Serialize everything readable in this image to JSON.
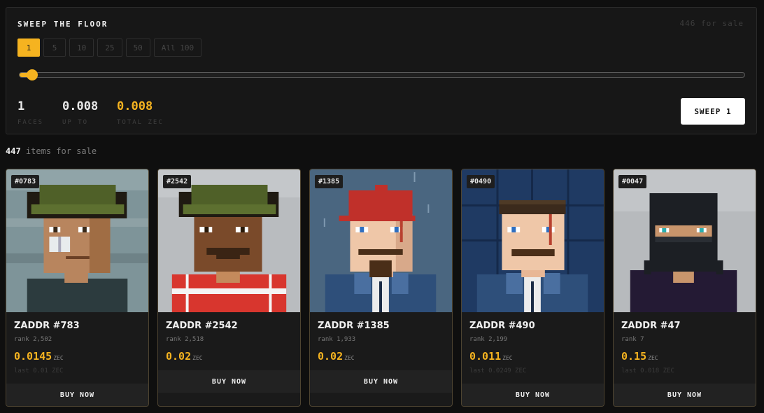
{
  "sweep": {
    "title": "SWEEP THE FLOOR",
    "for_sale": "446 for sale",
    "quantity_options": [
      "1",
      "5",
      "10",
      "25",
      "50",
      "All 100"
    ],
    "selected_quantity": "1",
    "slider_fraction": 0.01,
    "stats": {
      "faces_value": "1",
      "faces_label": "FACES",
      "upto_value": "0.008",
      "upto_label": "UP TO",
      "total_value": "0.008",
      "total_label": "TOTAL ZEC"
    },
    "button_label": "SWEEP 1"
  },
  "listing": {
    "count": "447",
    "suffix": "items for sale"
  },
  "cards": [
    {
      "id": "#0783",
      "name": "ZADDR #783",
      "rank": "rank 2,502",
      "price": "0.0145",
      "unit": "ZEC",
      "last": "last 0.01 ZEC",
      "buy": "BUY NOW"
    },
    {
      "id": "#2542",
      "name": "ZADDR #2542",
      "rank": "rank 2,518",
      "price": "0.02",
      "unit": "ZEC",
      "last": "",
      "buy": "BUY NOW"
    },
    {
      "id": "#1385",
      "name": "ZADDR #1385",
      "rank": "rank 1,933",
      "price": "0.02",
      "unit": "ZEC",
      "last": "",
      "buy": "BUY NOW"
    },
    {
      "id": "#0490",
      "name": "ZADDR #490",
      "rank": "rank 2,199",
      "price": "0.011",
      "unit": "ZEC",
      "last": "last 0.0249 ZEC",
      "buy": "BUY NOW"
    },
    {
      "id": "#0047",
      "name": "ZADDR #47",
      "rank": "rank 7",
      "price": "0.15",
      "unit": "ZEC",
      "last": "last 0.018 ZEC",
      "buy": "BUY NOW"
    }
  ],
  "colors": {
    "accent": "#f5b320",
    "card_border": "#4e4431"
  }
}
